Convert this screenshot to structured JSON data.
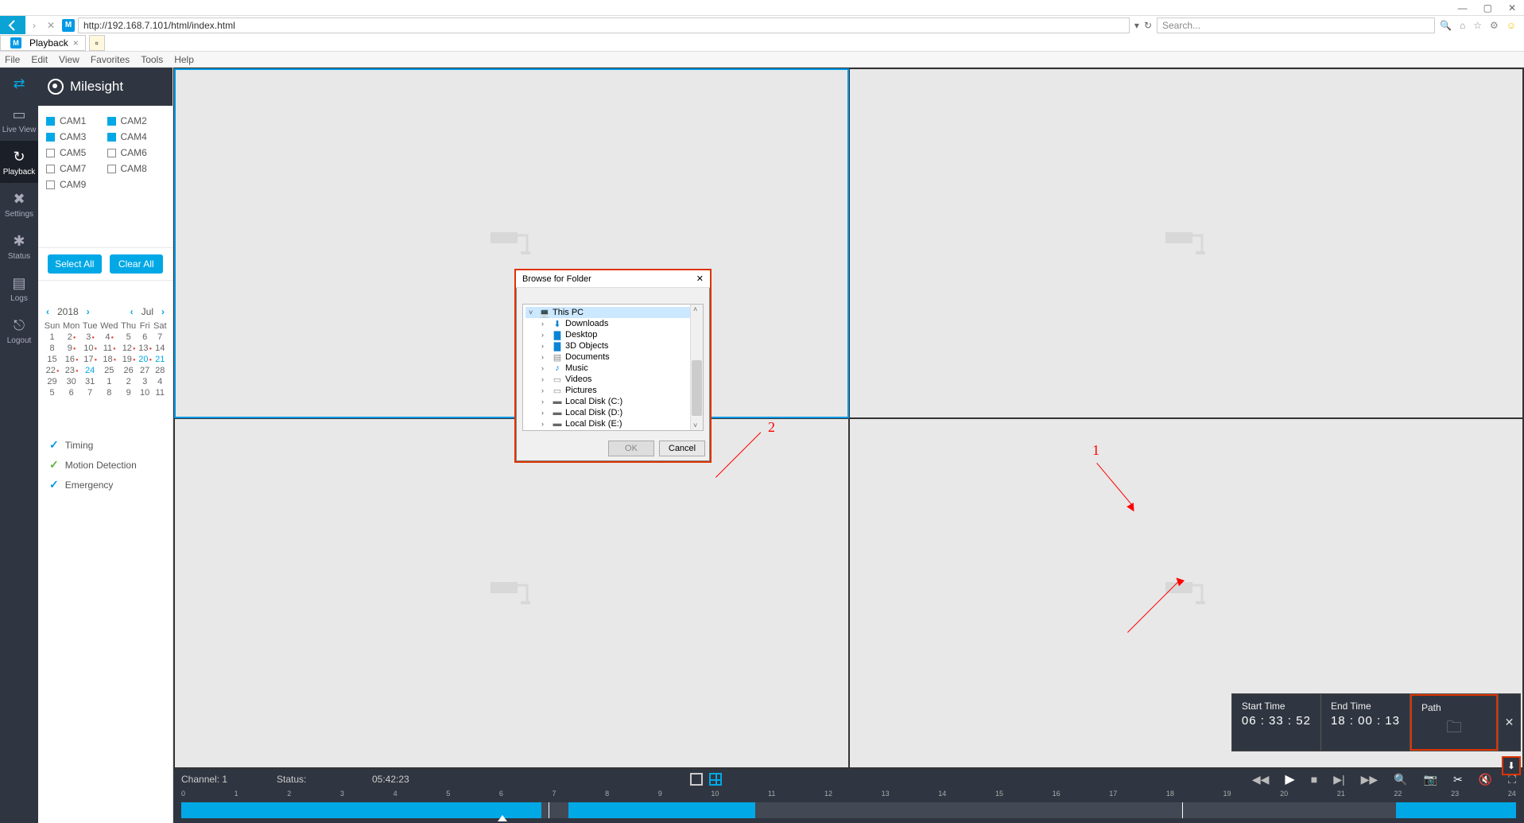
{
  "browser": {
    "window_controls": {
      "minimize": "—",
      "maximize": "▢",
      "close": "✕"
    },
    "url": "http://192.168.7.101/html/index.html",
    "search_placeholder": "Search...",
    "tab_title": "Playback",
    "menus": [
      "File",
      "Edit",
      "View",
      "Favorites",
      "Tools",
      "Help"
    ]
  },
  "brand": "Milesight",
  "rail": [
    {
      "label": "",
      "icon": "⇄"
    },
    {
      "label": "Live View",
      "icon": "▭"
    },
    {
      "label": "Playback",
      "icon": "↻"
    },
    {
      "label": "Settings",
      "icon": "✖"
    },
    {
      "label": "Status",
      "icon": "✱"
    },
    {
      "label": "Logs",
      "icon": "▤"
    },
    {
      "label": "Logout",
      "icon": "⎋"
    }
  ],
  "cameras": [
    {
      "name": "CAM1",
      "on": true
    },
    {
      "name": "CAM2",
      "on": true
    },
    {
      "name": "CAM3",
      "on": true
    },
    {
      "name": "CAM4",
      "on": true
    },
    {
      "name": "CAM5",
      "on": false
    },
    {
      "name": "CAM6",
      "on": false
    },
    {
      "name": "CAM7",
      "on": false
    },
    {
      "name": "CAM8",
      "on": false
    },
    {
      "name": "CAM9",
      "on": false
    }
  ],
  "buttons": {
    "select_all": "Select All",
    "clear_all": "Clear All"
  },
  "calendar": {
    "year": "2018",
    "month": "Jul",
    "dow": [
      "Sun",
      "Mon",
      "Tue",
      "Wed",
      "Thu",
      "Fri",
      "Sat"
    ],
    "weeks": [
      [
        {
          "d": "1"
        },
        {
          "d": "2",
          "dot": true
        },
        {
          "d": "3",
          "dot": true
        },
        {
          "d": "4",
          "dot": true
        },
        {
          "d": "5"
        },
        {
          "d": "6"
        },
        {
          "d": "7"
        }
      ],
      [
        {
          "d": "8"
        },
        {
          "d": "9",
          "dot": true
        },
        {
          "d": "10",
          "dot": true
        },
        {
          "d": "11",
          "dot": true
        },
        {
          "d": "12",
          "dot": true
        },
        {
          "d": "13",
          "dot": true
        },
        {
          "d": "14"
        }
      ],
      [
        {
          "d": "15"
        },
        {
          "d": "16",
          "dot": true
        },
        {
          "d": "17",
          "dot": true
        },
        {
          "d": "18",
          "dot": true
        },
        {
          "d": "19",
          "dot": true
        },
        {
          "d": "20",
          "blue": true,
          "dot": true
        },
        {
          "d": "21",
          "blue": true
        }
      ],
      [
        {
          "d": "22",
          "dot": true
        },
        {
          "d": "23",
          "dot": true
        },
        {
          "d": "24",
          "sel": true
        },
        {
          "d": "25"
        },
        {
          "d": "26"
        },
        {
          "d": "27"
        },
        {
          "d": "28"
        }
      ],
      [
        {
          "d": "29"
        },
        {
          "d": "30"
        },
        {
          "d": "31"
        },
        {
          "d": "1"
        },
        {
          "d": "2"
        },
        {
          "d": "3"
        },
        {
          "d": "4"
        }
      ],
      [
        {
          "d": "5"
        },
        {
          "d": "6"
        },
        {
          "d": "7"
        },
        {
          "d": "8"
        },
        {
          "d": "9"
        },
        {
          "d": "10"
        },
        {
          "d": "11"
        }
      ]
    ]
  },
  "legend": {
    "timing": "Timing",
    "motion": "Motion Detection",
    "emergency": "Emergency"
  },
  "status_bar": {
    "channel_label": "Channel:",
    "channel_value": "1",
    "status_label": "Status:",
    "time": "05:42:23"
  },
  "timeline_ticks": [
    "0",
    "1",
    "2",
    "3",
    "4",
    "5",
    "6",
    "7",
    "8",
    "9",
    "10",
    "11",
    "12",
    "13",
    "14",
    "15",
    "16",
    "17",
    "18",
    "19",
    "20",
    "21",
    "22",
    "23",
    "24"
  ],
  "download": {
    "start_label": "Start Time",
    "start_value": "06 : 33 : 52",
    "end_label": "End Time",
    "end_value": "18 : 00 : 13",
    "path_label": "Path"
  },
  "dialog": {
    "title": "Browse for Folder",
    "tree": [
      {
        "level": 0,
        "exp": "˅",
        "icon": "💻",
        "label": "This PC",
        "sel": true
      },
      {
        "level": 1,
        "exp": "›",
        "icon": "⬇",
        "label": "Downloads",
        "color": "#0a84d6"
      },
      {
        "level": 1,
        "exp": "›",
        "icon": "▇",
        "label": "Desktop",
        "color": "#0a84d6"
      },
      {
        "level": 1,
        "exp": "›",
        "icon": "▇",
        "label": "3D Objects",
        "color": "#0a84d6"
      },
      {
        "level": 1,
        "exp": "›",
        "icon": "▤",
        "label": "Documents",
        "color": "#888"
      },
      {
        "level": 1,
        "exp": "›",
        "icon": "♪",
        "label": "Music",
        "color": "#0a84d6"
      },
      {
        "level": 1,
        "exp": "›",
        "icon": "▭",
        "label": "Videos",
        "color": "#888"
      },
      {
        "level": 1,
        "exp": "›",
        "icon": "▭",
        "label": "Pictures",
        "color": "#888"
      },
      {
        "level": 1,
        "exp": "›",
        "icon": "▬",
        "label": "Local Disk (C:)",
        "color": "#666"
      },
      {
        "level": 1,
        "exp": "›",
        "icon": "▬",
        "label": "Local Disk (D:)",
        "color": "#666"
      },
      {
        "level": 1,
        "exp": "›",
        "icon": "▬",
        "label": "Local Disk (E:)",
        "color": "#666"
      }
    ],
    "ok": "OK",
    "cancel": "Cancel"
  },
  "annotations": {
    "one": "1",
    "two": "2"
  }
}
